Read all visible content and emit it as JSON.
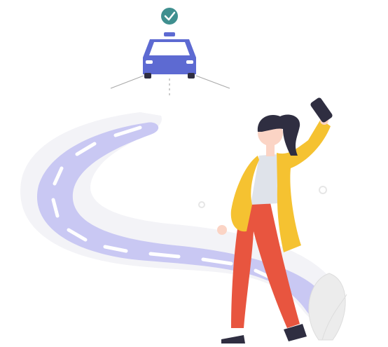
{
  "illustration": {
    "colors": {
      "road": "#c9c8f3",
      "road_shadow": "#f1f1f6",
      "road_markings": "#ffffff",
      "car_body": "#5d6ad2",
      "car_window": "#ffffff",
      "check_badge": "#3f8f8f",
      "coat": "#f5c231",
      "pants": "#e8553f",
      "hair": "#2f2e41",
      "skin": "#fbd4c5",
      "shirt": "#dfe3ea",
      "phone": "#2f2e41",
      "shoes": "#2f2e41",
      "plant": "#ececec",
      "guide_lines": "#aaaaaa"
    },
    "icons": [
      "taxi-icon",
      "check-badge-icon",
      "phone-icon"
    ]
  }
}
